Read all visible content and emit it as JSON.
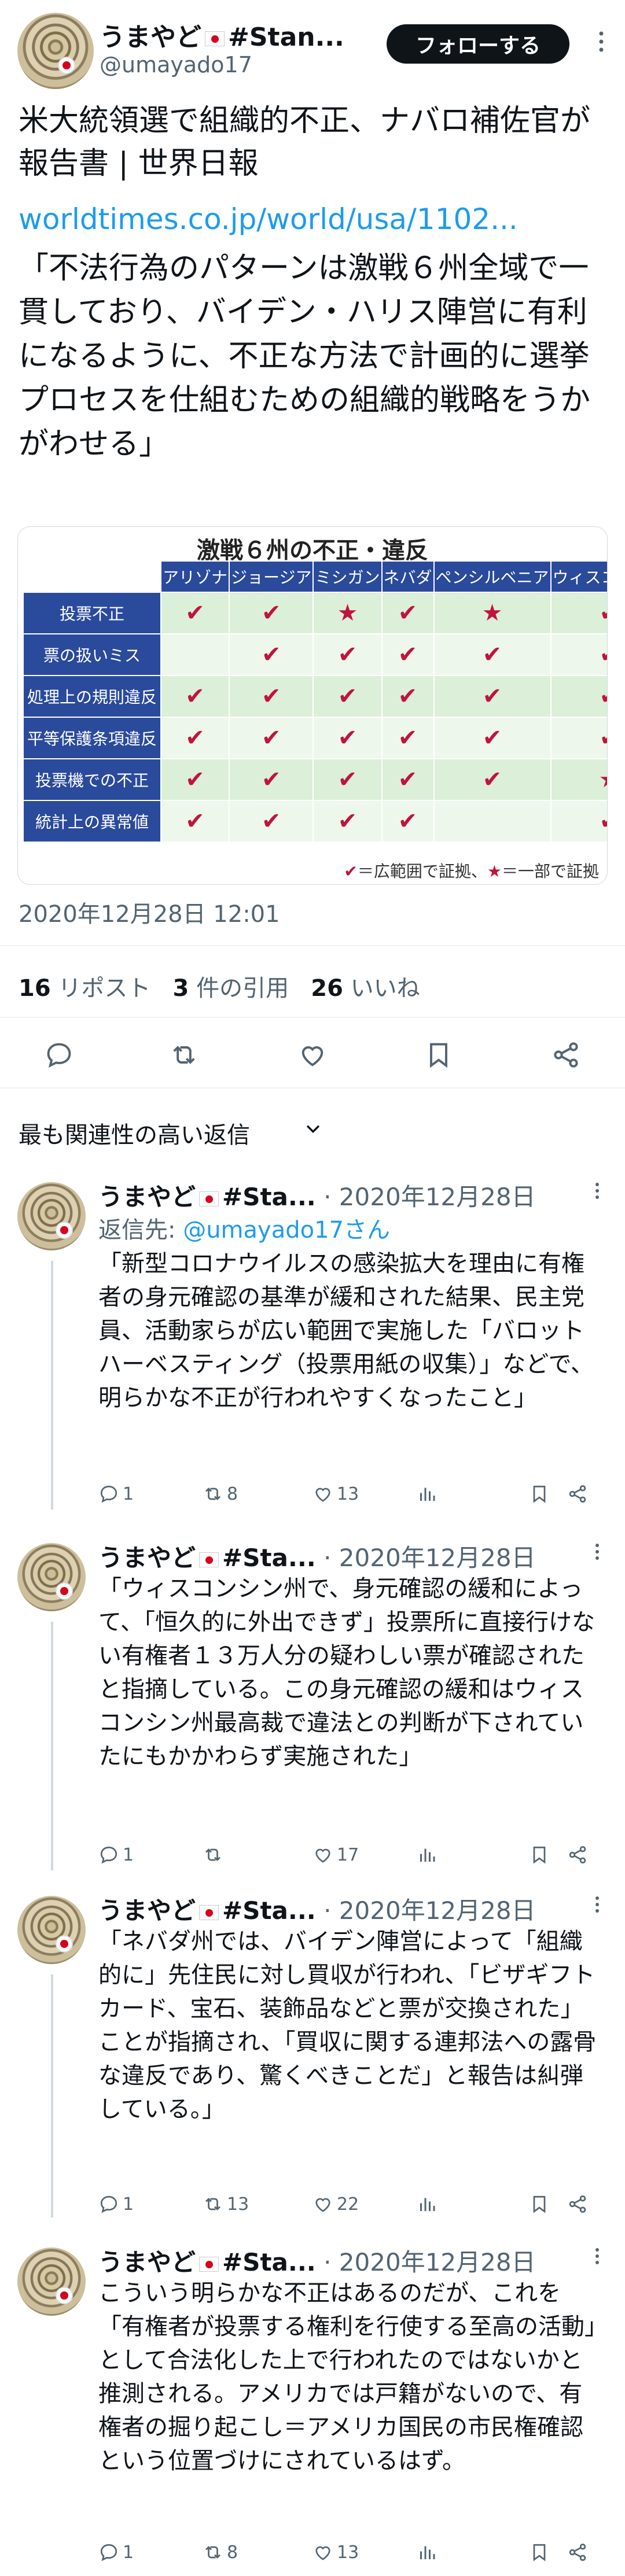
{
  "post": {
    "author_name": "うまやど",
    "author_name_suffix": "#Stan...",
    "author_handle": "@umayado17",
    "follow_label": "フォローする",
    "title": "米大統領選で組織的不正、ナバロ補佐官が報告書 | 世界日報",
    "link": "worldtimes.co.jp/world/usa/1102...",
    "quote": "「不法行為のパターンは激戦６州全域で一貫しており、バイデン・ハリス陣営に有利になるように、不正な方法で計画的に選挙プロセスを仕組むための組織的戦略をうかがわせる」",
    "date": "2020年12月28日 12:01",
    "reposts_count": "16",
    "reposts_label": "リポスト",
    "quotes_count": "3",
    "quotes_label": "件の引用",
    "likes_count": "26",
    "likes_label": "いいね"
  },
  "media": {
    "title": "激戦６州の不正・違反",
    "columns": [
      "アリゾナ",
      "ジョージア",
      "ミシガン",
      "ネバダ",
      "ペンシルベニア",
      "ウィスコンシン"
    ],
    "rows": [
      {
        "label": "投票不正",
        "marks": [
          "✔",
          "✔",
          "★",
          "✔",
          "★",
          "✔"
        ]
      },
      {
        "label": "票の扱いミス",
        "marks": [
          "",
          "✔",
          "✔",
          "✔",
          "✔",
          "✔"
        ]
      },
      {
        "label": "処理上の規則違反",
        "marks": [
          "✔",
          "✔",
          "✔",
          "✔",
          "✔",
          "✔"
        ]
      },
      {
        "label": "平等保護条項違反",
        "marks": [
          "✔",
          "✔",
          "✔",
          "✔",
          "✔",
          "✔"
        ]
      },
      {
        "label": "投票機での不正",
        "marks": [
          "✔",
          "✔",
          "✔",
          "✔",
          "✔",
          "★"
        ]
      },
      {
        "label": "統計上の異常値",
        "marks": [
          "✔",
          "✔",
          "✔",
          "✔",
          "",
          "✔"
        ]
      }
    ],
    "legend_check": "✔",
    "legend_check_text": "＝広範囲で証拠、",
    "legend_star": "★",
    "legend_star_text": "＝一部で証拠",
    "mark_color": "#c0143c",
    "header_color": "#2a4a9c"
  },
  "sort_label": "最も関連性の高い返信",
  "replies": [
    {
      "name": "うまやど",
      "name_suffix": "#Sta...",
      "date": "· 2020年12月28日",
      "replying_prefix": "返信先: ",
      "replying_handle": "@umayado17さん",
      "body": "「新型コロナウイルスの感染拡大を理由に有権者の身元確認の基準が緩和された結果、民主党員、活動家らが広い範囲で実施した「バロットハーベスティング（投票用紙の収集）」などで、明らかな不正が行われやすくなったこと」",
      "replies": "1",
      "reposts": "8",
      "likes": "13"
    },
    {
      "name": "うまやど",
      "name_suffix": "#Sta...",
      "date": "· 2020年12月28日",
      "body": "「ウィスコンシン州で、身元確認の緩和によって、「恒久的に外出できず」投票所に直接行けない有権者１３万人分の疑わしい票が確認されたと指摘している。この身元確認の緩和はウィスコンシン州最高裁で違法との判断が下されていたにもかかわらず実施された」",
      "replies": "1",
      "reposts": "",
      "likes": "17"
    },
    {
      "name": "うまやど",
      "name_suffix": "#Sta...",
      "date": "· 2020年12月28日",
      "body": "「ネバダ州では、バイデン陣営によって「組織的に」先住民に対し買収が行われ、「ビザギフトカード、宝石、装飾品などと票が交換された」ことが指摘され、「買収に関する連邦法への露骨な違反であり、驚くべきことだ」と報告は糾弾している。」",
      "replies": "1",
      "reposts": "13",
      "likes": "22"
    },
    {
      "name": "うまやど",
      "name_suffix": "#Sta...",
      "date": "· 2020年12月28日",
      "body": "こういう明らかな不正はあるのだが、これを「有権者が投票する権利を行使する至高の活動」として合法化した上で行われたのではないかと推測される。アメリカでは戸籍がないので、有権者の掘り起こし＝アメリカ国民の市民権確認という位置づけにされているはず。",
      "replies": "1",
      "reposts": "8",
      "likes": "13"
    }
  ],
  "icons": [
    "reply-icon",
    "repost-icon",
    "like-icon",
    "bookmark-icon",
    "share-icon",
    "views-icon",
    "more-icon",
    "chevron-down-icon"
  ],
  "colors": {
    "link": "#1d9bf0",
    "secondary": "#536471",
    "text": "#0f1419",
    "follow_bg": "#0f1419"
  }
}
